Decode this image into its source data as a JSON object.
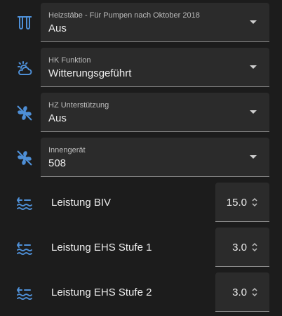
{
  "colors": {
    "icon": "#4e8fd6",
    "background": "#1c1c1c",
    "field": "#2b2b2b"
  },
  "selects": [
    {
      "label": "Heizstäbe - Für Pumpen nach Oktober 2018",
      "value": "Aus",
      "icon": "heating-rods-icon"
    },
    {
      "label": "HK Funktion",
      "value": "Witterungsgeführt",
      "icon": "weather-sun-cloud-icon"
    },
    {
      "label": "HZ Unterstützung",
      "value": "Aus",
      "icon": "fan-off-icon"
    },
    {
      "label": "Innengerät",
      "value": "508",
      "icon": "fan-off-icon"
    }
  ],
  "numbers": [
    {
      "label": "Leistung BIV",
      "value": "15.0",
      "icon": "water-heat-icon"
    },
    {
      "label": "Leistung EHS Stufe 1",
      "value": "3.0",
      "icon": "water-heat-icon"
    },
    {
      "label": "Leistung EHS Stufe 2",
      "value": "3.0",
      "icon": "water-heat-icon"
    }
  ]
}
